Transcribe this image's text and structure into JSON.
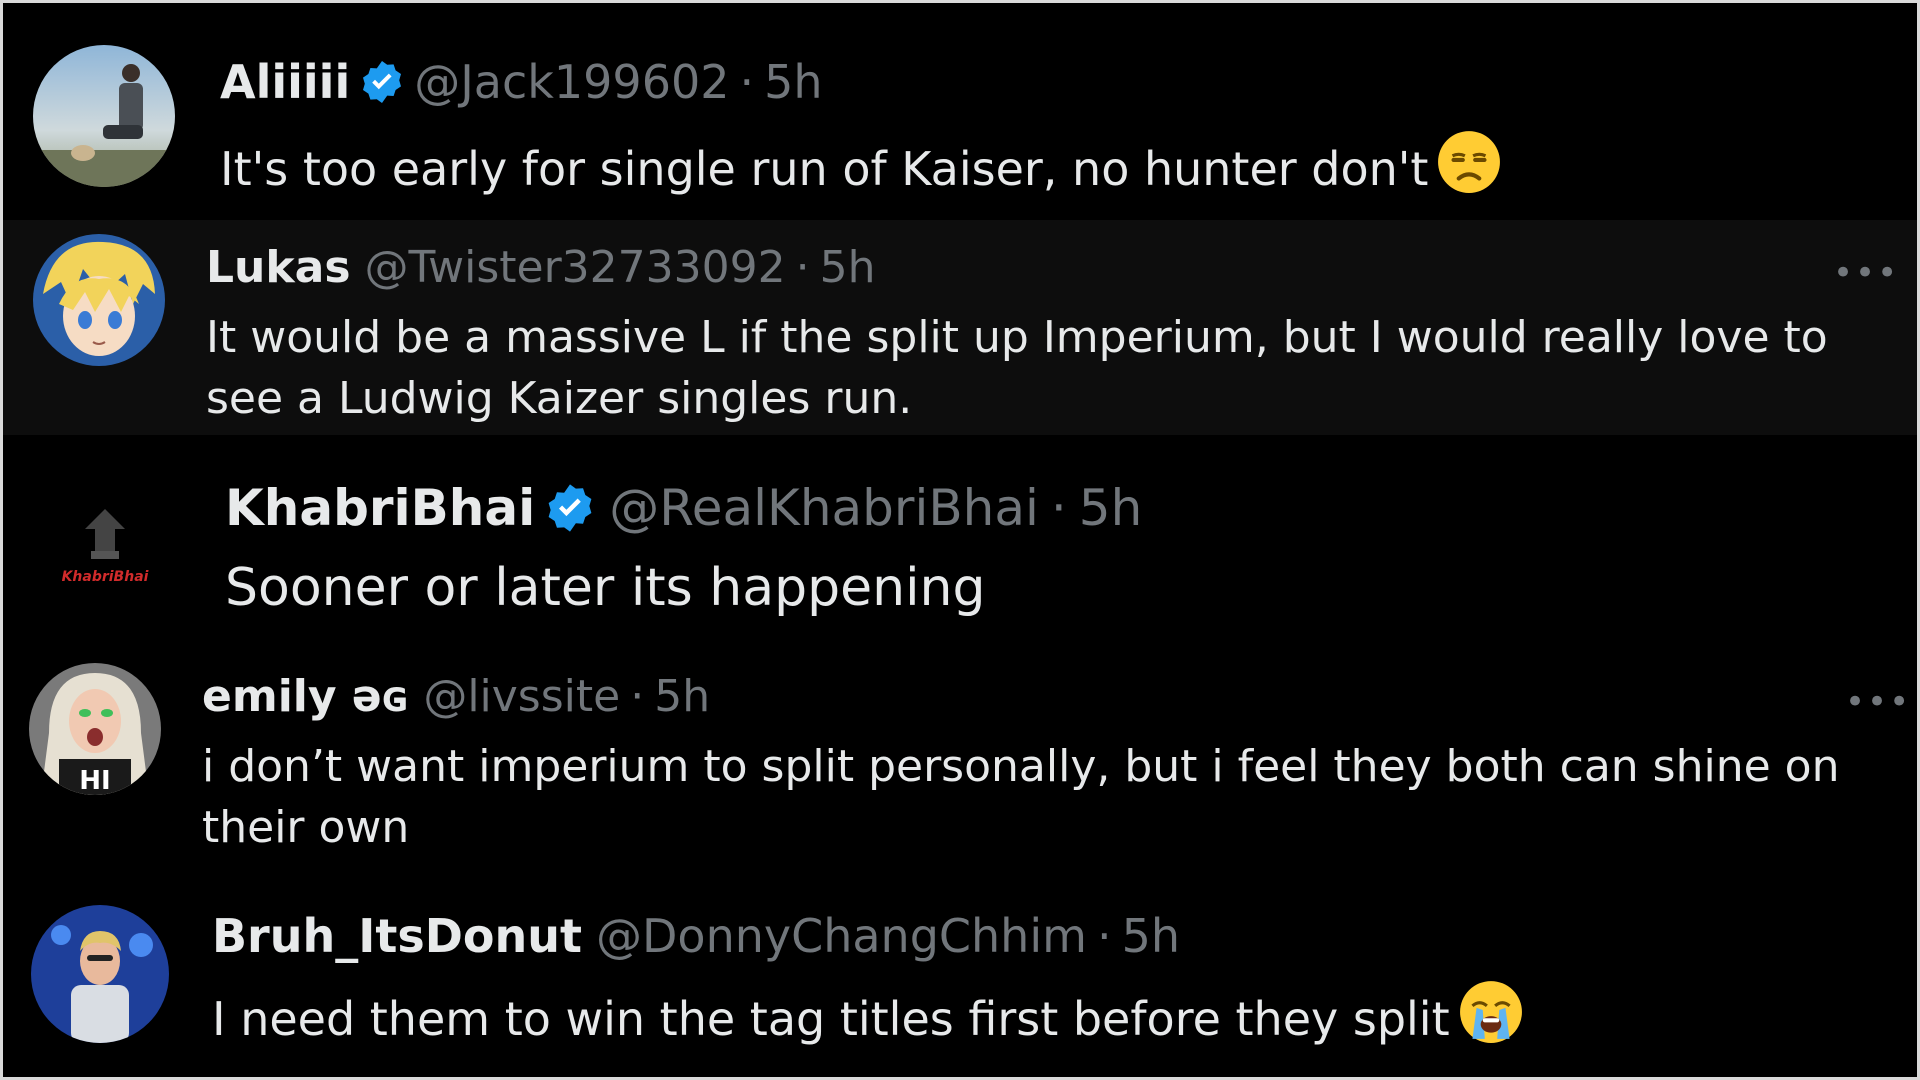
{
  "replies": [
    {
      "name": "Aliiiii",
      "verified": true,
      "handle": "@Jack199602",
      "separator": "·",
      "time": "5h",
      "text": "It's too early for single run of Kaiser, no hunter don't",
      "emoji": "unamused-face-icon",
      "has_more_menu": false
    },
    {
      "name": "Lukas",
      "verified": false,
      "handle": "@Twister32733092",
      "separator": "·",
      "time": "5h",
      "text_line1": "It would be a massive L if the split up Imperium, but I would really love to",
      "text_line2": "see a Ludwig Kaizer singles run.",
      "has_more_menu": true,
      "more_label": "•••"
    },
    {
      "name": "KhabriBhai",
      "verified": true,
      "handle": "@RealKhabriBhai",
      "separator": "·",
      "time": "5h",
      "text": "Sooner or later its happening",
      "avatar_text": "KhabriBhai",
      "has_more_menu": false
    },
    {
      "name": "emily əɢ",
      "verified": false,
      "handle": "@livssite",
      "separator": "·",
      "time": "5h",
      "text_line1": "i don’t want imperium to split personally, but i feel they both can shine on",
      "text_line2": "their own",
      "avatar_text": "HI",
      "has_more_menu": true,
      "more_label": "•••"
    },
    {
      "name": "Bruh_ItsDonut",
      "verified": false,
      "handle": "@DonnyChangChhim",
      "separator": "·",
      "time": "5h",
      "text": "I need them to win the tag titles first before they split",
      "emoji": "loudly-crying-face-icon",
      "has_more_menu": false
    }
  ],
  "colors": {
    "background": "#000000",
    "highlighted_row": "#0d0d0d",
    "text_primary": "#e7e9ea",
    "text_secondary": "#71767b",
    "verified_blue": "#1d9bf0",
    "frame_border": "#d9d9d9"
  }
}
